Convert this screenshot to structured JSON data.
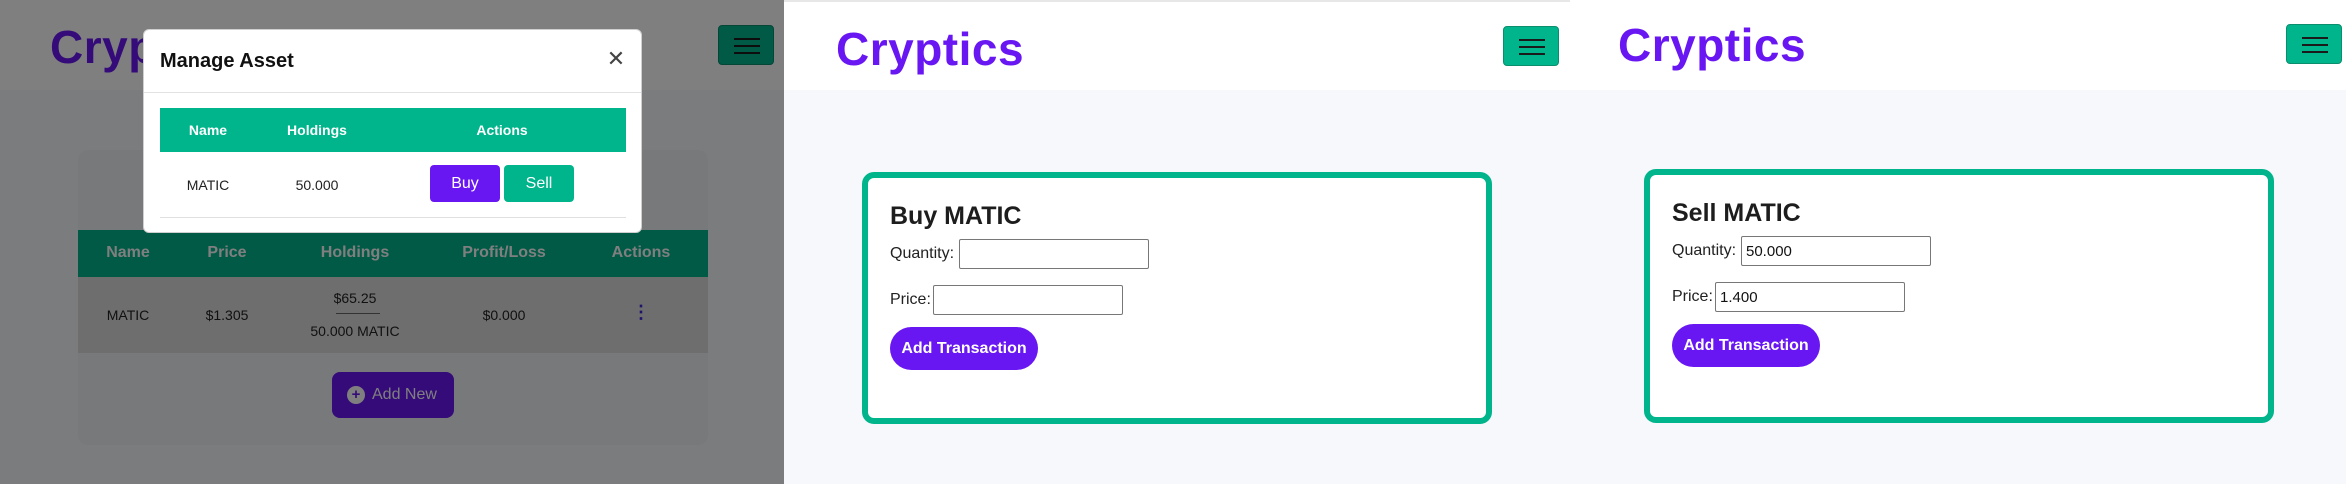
{
  "brand": "Cryptics",
  "colors": {
    "brand": "#6816f2",
    "accent": "#00b48c"
  },
  "portfolio": {
    "columns": [
      "Name",
      "Price",
      "Holdings",
      "Profit/Loss",
      "Actions"
    ],
    "rows": [
      {
        "name": "MATIC",
        "price": "$1.305",
        "holdings_value": "$65.25",
        "holdings_amount": "50.000 MATIC",
        "profit_loss": "$0.000",
        "actions_icon": "kebab-menu-icon"
      }
    ],
    "add_new_label": "Add New"
  },
  "modal": {
    "title": "Manage Asset",
    "columns": [
      "Name",
      "Holdings",
      "Actions"
    ],
    "rows": [
      {
        "name": "MATIC",
        "holdings": "50.000",
        "buy_label": "Buy",
        "sell_label": "Sell"
      }
    ]
  },
  "buy_form": {
    "title": "Buy MATIC",
    "quantity_label": "Quantity:",
    "quantity_value": "",
    "price_label": "Price:",
    "price_value": "",
    "submit_label": "Add Transaction"
  },
  "sell_form": {
    "title": "Sell MATIC",
    "quantity_label": "Quantity:",
    "quantity_value": "50.000",
    "price_label": "Price:",
    "price_value": "1.400",
    "submit_label": "Add Transaction"
  }
}
